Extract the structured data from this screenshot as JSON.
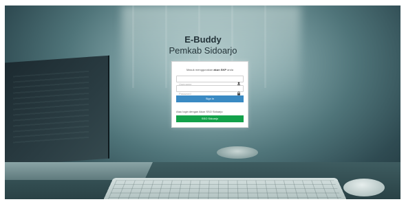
{
  "header": {
    "title": "E-Buddy",
    "subtitle": "Pemkab Sidoarjo"
  },
  "login": {
    "intro_prefix": "Masuk menggunakan ",
    "intro_bold": "akun SKP",
    "intro_suffix": " anda",
    "username_placeholder": "Username",
    "password_placeholder": "Password",
    "signin_label": "Sign in",
    "alt_text": "Atau login dengan Akun SSO Sidoarjo",
    "sso_label": "SSO Sidoarjo"
  },
  "icons": {
    "username": "user-icon",
    "password": "lock-icon"
  },
  "colors": {
    "signin": "#3a8ac3",
    "sso": "#13a14a"
  }
}
